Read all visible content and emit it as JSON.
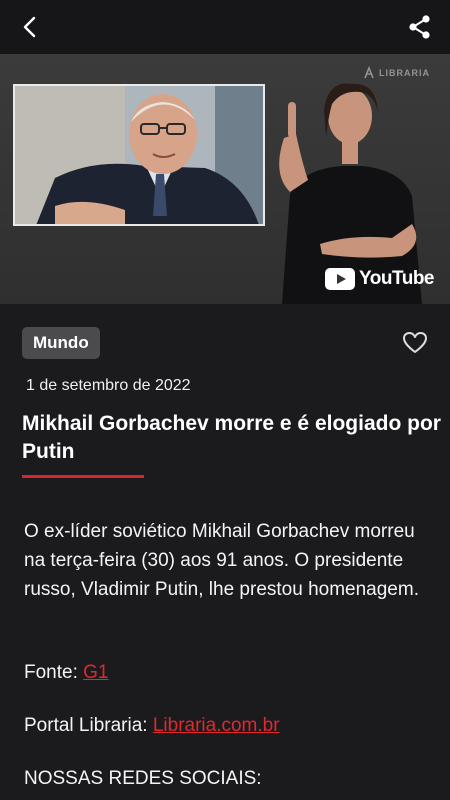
{
  "topbar": {
    "back_icon": "chevron-left-icon",
    "share_icon": "share-icon"
  },
  "video": {
    "watermark": "LIBRARIA",
    "youtube_label": "YouTube"
  },
  "article": {
    "category": "Mundo",
    "date": "1 de setembro de 2022",
    "title": "Mikhail Gorbachev morre e é elogiado por Putin",
    "body": "O ex-líder soviético Mikhail Gorbachev morreu na terça-feira (30) aos 91 anos. O presidente russo, Vladimir Putin, lhe prestou homenagem.",
    "source_label": "Fonte: ",
    "source_link": "G1",
    "portal_label": "Portal Libraria: ",
    "portal_link": "Libraria.com.br",
    "social_heading": "NOSSAS REDES SOCIAIS:"
  },
  "colors": {
    "accent": "#d8262a",
    "background": "#1b1b1e",
    "tag_bg": "#4a4a4f"
  }
}
